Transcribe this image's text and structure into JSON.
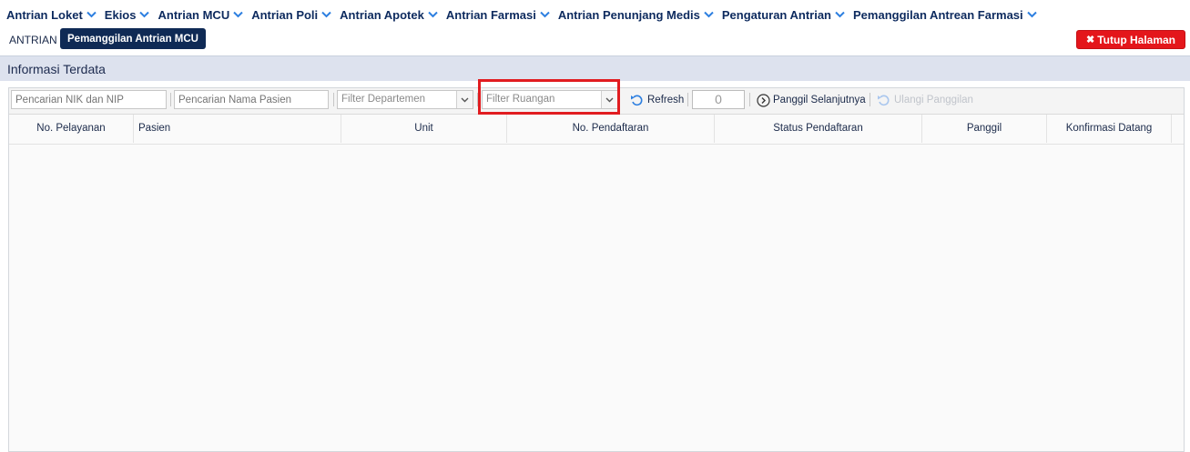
{
  "nav": {
    "items": [
      {
        "label": "Antrian Loket"
      },
      {
        "label": "Ekios"
      },
      {
        "label": "Antrian MCU"
      },
      {
        "label": "Antrian Poli"
      },
      {
        "label": "Antrian Apotek"
      },
      {
        "label": "Antrian Farmasi"
      },
      {
        "label": "Antrian Penunjang Medis"
      },
      {
        "label": "Pengaturan Antrian"
      },
      {
        "label": "Pemanggilan Antrean Farmasi"
      }
    ]
  },
  "tabs": {
    "antrian": "ANTRIAN",
    "active": "Pemanggilan Antrian MCU"
  },
  "close_button": {
    "label": "Tutup Halaman",
    "color": "#e4161b"
  },
  "panel": {
    "title": "Informasi Terdata"
  },
  "toolbar": {
    "search_nik_placeholder": "Pencarian NIK dan NIP",
    "search_nama_placeholder": "Pencarian Nama Pasien",
    "filter_departemen": "Filter Departemen",
    "filter_ruangan": "Filter Ruangan",
    "refresh_label": "Refresh",
    "counter_value": "0",
    "next_call_label": "Panggil Selanjutnya",
    "recall_label": "Ulangi Panggilan"
  },
  "table": {
    "columns": [
      "No. Pelayanan",
      "Pasien",
      "Unit",
      "No. Pendaftaran",
      "Status Pendaftaran",
      "Panggil",
      "Konfirmasi Datang"
    ],
    "rows": []
  },
  "colors": {
    "accent": "#0f2a55",
    "highlight": "#e11c20",
    "link_icon": "#2d7fe0"
  }
}
